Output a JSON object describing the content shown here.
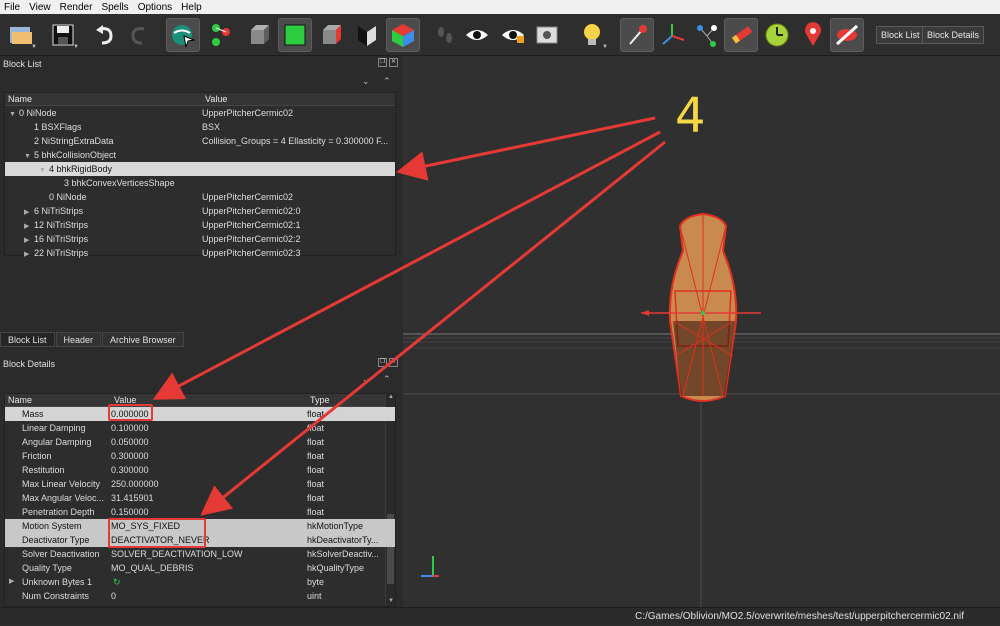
{
  "menu": [
    "File",
    "View",
    "Render",
    "Spells",
    "Options",
    "Help"
  ],
  "toolbar": {
    "block_list_label": "Block List",
    "block_details_label": "Block Details",
    "icons": [
      "open-file-icon",
      "save-icon",
      "undo-icon",
      "redo-icon",
      "globe-select-icon",
      "node-select-icon",
      "cube-gray-icon",
      "cube-green-icon",
      "cube-red-side-icon",
      "cube-half-icon",
      "cube-color-icon",
      "footprints-icon",
      "eye-icon",
      "eye-tag-icon",
      "screenshot-icon",
      "lightbulb-icon",
      "pin-vertex-icon",
      "axes-icon",
      "graph-icon",
      "brush-icon",
      "clock-icon",
      "map-pin-icon",
      "no-collision-icon"
    ]
  },
  "block_list": {
    "title": "Block List",
    "columns": [
      "Name",
      "Value"
    ],
    "rows": [
      {
        "name": "0 NiNode",
        "value": "UpperPitcherCermic02",
        "indent": 0,
        "arrow": "down"
      },
      {
        "name": "1 BSXFlags",
        "value": "BSX",
        "indent": 1,
        "arrow": ""
      },
      {
        "name": "2 NiStringExtraData",
        "value": "Collision_Groups = 4  Ellasticity = 0.300000  F...",
        "indent": 1,
        "arrow": ""
      },
      {
        "name": "5 bhkCollisionObject",
        "value": "",
        "indent": 1,
        "arrow": "down"
      },
      {
        "name": "4 bhkRigidBody",
        "value": "",
        "indent": 2,
        "arrow": "down",
        "selected": true
      },
      {
        "name": "3 bhkConvexVerticesShape",
        "value": "",
        "indent": 3,
        "arrow": ""
      },
      {
        "name": "0 NiNode",
        "value": "UpperPitcherCermic02",
        "indent": 2,
        "arrow": ""
      },
      {
        "name": "6 NiTriStrips",
        "value": "UpperPitcherCermic02:0",
        "indent": 1,
        "arrow": "right"
      },
      {
        "name": "12 NiTriStrips",
        "value": "UpperPitcherCermic02:1",
        "indent": 1,
        "arrow": "right"
      },
      {
        "name": "16 NiTriStrips",
        "value": "UpperPitcherCermic02:2",
        "indent": 1,
        "arrow": "right"
      },
      {
        "name": "22 NiTriStrips",
        "value": "UpperPitcherCermic02:3",
        "indent": 1,
        "arrow": "right"
      }
    ]
  },
  "tabs": [
    "Block List",
    "Header",
    "Archive Browser"
  ],
  "block_details": {
    "title": "Block Details",
    "columns": [
      "Name",
      "Value",
      "Type"
    ],
    "rows": [
      {
        "name": "Mass",
        "value": "0.000000",
        "type": "float",
        "hl": 1
      },
      {
        "name": "Linear Damping",
        "value": "0.100000",
        "type": "float"
      },
      {
        "name": "Angular Damping",
        "value": "0.050000",
        "type": "float"
      },
      {
        "name": "Friction",
        "value": "0.300000",
        "type": "float"
      },
      {
        "name": "Restitution",
        "value": "0.300000",
        "type": "float"
      },
      {
        "name": "Max Linear Velocity",
        "value": "250.000000",
        "type": "float"
      },
      {
        "name": "Max Angular Veloc...",
        "value": "31.415901",
        "type": "float"
      },
      {
        "name": "Penetration Depth",
        "value": "0.150000",
        "type": "float"
      },
      {
        "name": "Motion System",
        "value": "MO_SYS_FIXED",
        "type": "hkMotionType",
        "hl": 2
      },
      {
        "name": "Deactivator Type",
        "value": "DEACTIVATOR_NEVER",
        "type": "hkDeactivatorTy...",
        "hl": 2
      },
      {
        "name": "Solver Deactivation",
        "value": "SOLVER_DEACTIVATION_LOW",
        "type": "hkSolverDeactiv..."
      },
      {
        "name": "Quality Type",
        "value": "MO_QUAL_DEBRIS",
        "type": "hkQualityType"
      },
      {
        "name": "Unknown Bytes 1",
        "value": "",
        "type": "byte",
        "arrow": true
      },
      {
        "name": "Num Constraints",
        "value": "0",
        "type": "uint"
      }
    ]
  },
  "status": "C:/Games/Oblivion/MO2.5/overwrite/meshes/test/upperpitchercermic02.nif",
  "annotation": {
    "number": "4",
    "color": "#e53935",
    "number_color": "#f5d742"
  }
}
